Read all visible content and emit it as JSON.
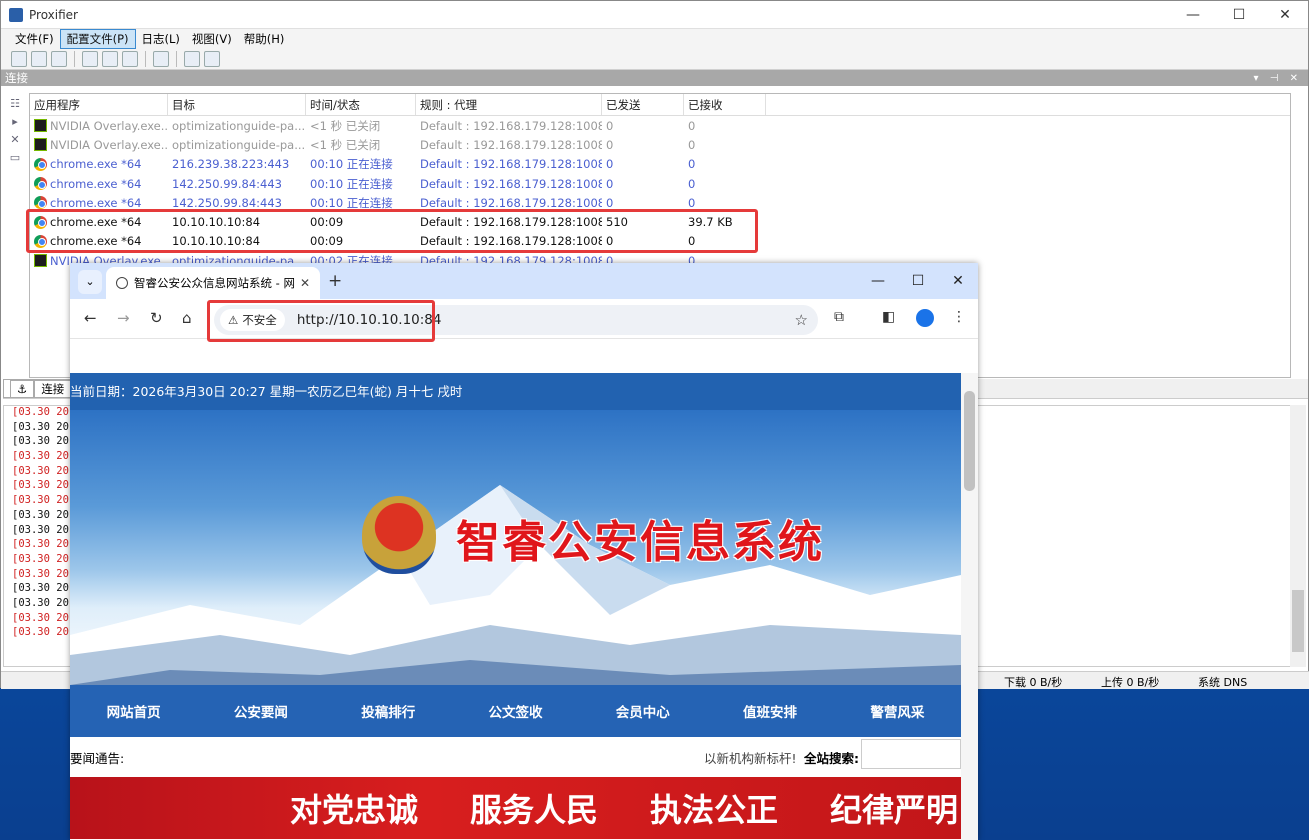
{
  "proxifier": {
    "title": "Proxifier",
    "menu": [
      "文件(F)",
      "配置文件(P)",
      "日志(L)",
      "视图(V)",
      "帮助(H)"
    ],
    "panel_title": "连接",
    "columns": [
      "应用程序",
      "目标",
      "时间/状态",
      "规则 : 代理",
      "已发送",
      "已接收"
    ],
    "rows": [
      {
        "app": "NVIDIA Overlay.exe...",
        "target": "optimizationguide-pa...",
        "time": "<1 秒 已关闭",
        "rule": "Default : 192.168.179.128:1008...",
        "sent": "0",
        "recv": "0"
      },
      {
        "app": "NVIDIA Overlay.exe...",
        "target": "optimizationguide-pa...",
        "time": "<1 秒 已关闭",
        "rule": "Default : 192.168.179.128:1008...",
        "sent": "0",
        "recv": "0"
      },
      {
        "app": "chrome.exe *64",
        "target": "216.239.38.223:443",
        "time": "00:10 正在连接",
        "rule": "Default : 192.168.179.128:1008...",
        "sent": "0",
        "recv": "0"
      },
      {
        "app": "chrome.exe *64",
        "target": "142.250.99.84:443",
        "time": "00:10 正在连接",
        "rule": "Default : 192.168.179.128:1008...",
        "sent": "0",
        "recv": "0"
      },
      {
        "app": "chrome.exe *64",
        "target": "142.250.99.84:443",
        "time": "00:10 正在连接",
        "rule": "Default : 192.168.179.128:1008...",
        "sent": "0",
        "recv": "0"
      },
      {
        "app": "chrome.exe *64",
        "target": "10.10.10.10:84",
        "time": "00:09",
        "rule": "Default : 192.168.179.128:1008...",
        "sent": "510",
        "recv": "39.7 KB"
      },
      {
        "app": "chrome.exe *64",
        "target": "10.10.10.10:84",
        "time": "00:09",
        "rule": "Default : 192.168.179.128:1008...",
        "sent": "0",
        "recv": "0"
      },
      {
        "app": "NVIDIA Overlay.exe...",
        "target": "optimizationguide-pa...",
        "time": "00:02 正在连接",
        "rule": "Default : 192.168.179.128:1008...",
        "sent": "0",
        "recv": "0"
      }
    ],
    "tab_connections": "连接",
    "log_lines": [
      "[03.30 20:2",
      "[03.30 20:2",
      "[03.30 20:2",
      "[03.30 20:2",
      "[03.30 20:2",
      "[03.30 20:2",
      "[03.30 20:2",
      "[03.30 20:2",
      "[03.30 20:2",
      "[03.30 20:2",
      "[03.30 20:2",
      "[03.30 20:2",
      "[03.30 20:2",
      "[03.30 20:2",
      "[03.30 20:2",
      "[03.30 20:2"
    ],
    "status": {
      "download": "下载 0 B/秒",
      "upload": "上传 0 B/秒",
      "dns": "系统 DNS"
    }
  },
  "chrome": {
    "tab_title": "智睿公安公众信息网站系统 - 网",
    "not_secure": "不安全",
    "url": "http://10.10.10.10:84"
  },
  "site": {
    "date": "当前日期：2026年3月30日 20:27 星期一农历乙巳年(蛇) 月十七 戌时",
    "banner_title": "智睿公安信息系统",
    "nav": [
      "网站首页",
      "公安要闻",
      "投稿排行",
      "公文签收",
      "会员中心",
      "值班安排",
      "警营风采"
    ],
    "notice_label": "要闻通告:",
    "notice_text": "以新机构新标杆!",
    "search_label": "全站搜索:",
    "slogans": [
      "对党忠诚",
      "服务人民",
      "执法公正",
      "纪律严明"
    ]
  }
}
